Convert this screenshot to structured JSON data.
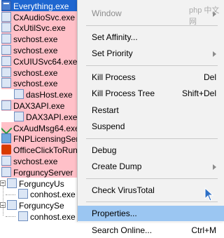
{
  "process_list": {
    "rows": [
      {
        "name": "Everything.exe",
        "icon": "app-icon",
        "selected": true
      },
      {
        "name": "CxAudioSvc.exe",
        "icon": "window-icon",
        "bg": "#ffc0c8"
      },
      {
        "name": "CxUtilSvc.exe",
        "icon": "window-icon",
        "bg": "#ffc0c8"
      },
      {
        "name": "svchost.exe",
        "icon": "window-icon",
        "bg": "#ffc0c8"
      },
      {
        "name": "svchost.exe",
        "icon": "window-icon",
        "bg": "#ffc0c8"
      },
      {
        "name": "CxUIUSvc64.exe",
        "icon": "window-icon",
        "bg": "#ffc0c8"
      },
      {
        "name": "svchost.exe",
        "icon": "window-icon",
        "bg": "#ffc0c8"
      },
      {
        "name": "svchost.exe",
        "icon": "window-icon",
        "bg": "#ffc0c8"
      },
      {
        "name": "dasHost.exe",
        "icon": "window-icon",
        "bg": "#ffc0c8"
      },
      {
        "name": "DAX3API.exe",
        "icon": "window-icon",
        "bg": "#ffc0c8"
      },
      {
        "name": "DAX3API.exe",
        "icon": "window-icon",
        "bg": "#ffc0c8"
      },
      {
        "name": "CxAudMsg64.exe",
        "icon": "audio-check-icon",
        "bg": "#ffc0c8"
      },
      {
        "name": "FNPLicensingService",
        "icon": "generic-icon",
        "bg": "#ffc0c8"
      },
      {
        "name": "OfficeClickToRun",
        "icon": "office-icon",
        "bg": "#ffc0c8"
      },
      {
        "name": "svchost.exe",
        "icon": "window-icon",
        "bg": "#ffc0c8"
      },
      {
        "name": "ForguncyServer",
        "icon": "window-icon",
        "bg": "#ffc0c8"
      },
      {
        "name": "ForguncyUs",
        "icon": "window-icon",
        "bg": "#ffffff"
      },
      {
        "name": "conhost.exe",
        "icon": "window-icon",
        "bg": "#ffffff"
      },
      {
        "name": "ForguncySe",
        "icon": "window-icon",
        "bg": "#ffffff"
      },
      {
        "name": "conhost.exe",
        "icon": "window-icon",
        "bg": "#ffffff"
      }
    ]
  },
  "context_menu": {
    "items": [
      {
        "label": "Window",
        "shortcut": "",
        "disabled": true,
        "submenu": true
      },
      {
        "sep": true
      },
      {
        "label": "Set Affinity...",
        "shortcut": ""
      },
      {
        "label": "Set Priority",
        "shortcut": "",
        "submenu": true
      },
      {
        "sep": true
      },
      {
        "label": "Kill Process",
        "shortcut": "Del"
      },
      {
        "label": "Kill Process Tree",
        "shortcut": "Shift+Del"
      },
      {
        "label": "Restart",
        "shortcut": ""
      },
      {
        "label": "Suspend",
        "shortcut": ""
      },
      {
        "sep": true
      },
      {
        "label": "Debug",
        "shortcut": ""
      },
      {
        "label": "Create Dump",
        "shortcut": "",
        "submenu": true
      },
      {
        "sep": true
      },
      {
        "label": "Check VirusTotal",
        "shortcut": ""
      },
      {
        "sep": true
      },
      {
        "label": "Properties...",
        "shortcut": "",
        "highlighted": true
      },
      {
        "label": "Search Online...",
        "shortcut": "Ctrl+M"
      }
    ]
  },
  "watermark": "php 中文网",
  "colors": {
    "selected_bg": "#1e66d0",
    "service_bg": "#ffc0c8",
    "menu_bg": "#f2f2f2",
    "menu_highlight": "#9bc6f2"
  }
}
